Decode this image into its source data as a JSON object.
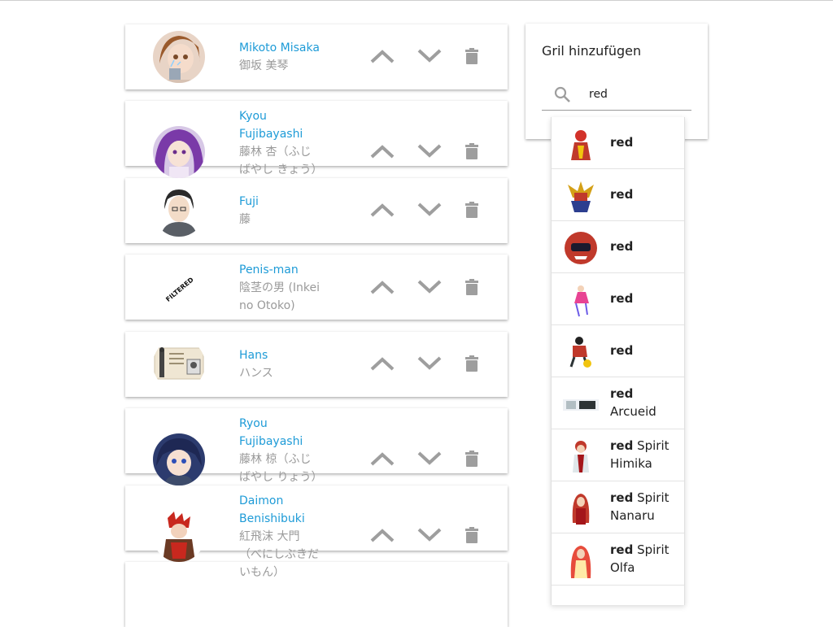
{
  "list": [
    {
      "name": "Mikoto Misaka",
      "native": "御坂 美琴",
      "avatar_kind": "avatar-mikoto"
    },
    {
      "name": "Kyou Fujibayashi",
      "native": "藤林 杏（ふじばやし きょう）",
      "avatar_kind": "avatar-kyou"
    },
    {
      "name": "Fuji",
      "native": "藤",
      "avatar_kind": "avatar-fuji"
    },
    {
      "name": "Penis-man",
      "native": "陰茎の男 (Inkei no Otoko)",
      "avatar_kind": "avatar-filtered",
      "avatar_text": "FILTERED"
    },
    {
      "name": "Hans",
      "native": "ハンス",
      "avatar_kind": "avatar-hans"
    },
    {
      "name": "Ryou Fujibayashi",
      "native": "藤林 椋（ふじばやし りょう）",
      "avatar_kind": "avatar-ryou"
    },
    {
      "name": "Daimon Benishibuki",
      "native": "紅飛沫 大門（べにしぶきだいもん）",
      "avatar_kind": "avatar-daimon"
    }
  ],
  "actions": {
    "up_icon": "chevron-up-icon",
    "down_icon": "chevron-down-icon",
    "delete_icon": "trash-icon"
  },
  "panel": {
    "title": "Gril hinzufügen",
    "search_value": "red",
    "search_icon": "search-icon"
  },
  "suggestions": [
    {
      "bold": "red",
      "rest": ""
    },
    {
      "bold": "red",
      "rest": ""
    },
    {
      "bold": "red",
      "rest": ""
    },
    {
      "bold": "red",
      "rest": ""
    },
    {
      "bold": "red",
      "rest": ""
    },
    {
      "bold": "red",
      "rest": "Arcueid"
    },
    {
      "bold": "red",
      "rest": "Spirit Himika"
    },
    {
      "bold": "red",
      "rest": "Spirit Nanaru"
    },
    {
      "bold": "red",
      "rest": "Spirit Olfa"
    }
  ],
  "colors": {
    "link": "#1e9bd7",
    "icon": "#9e9e9e",
    "muted": "#9a9a9a"
  }
}
